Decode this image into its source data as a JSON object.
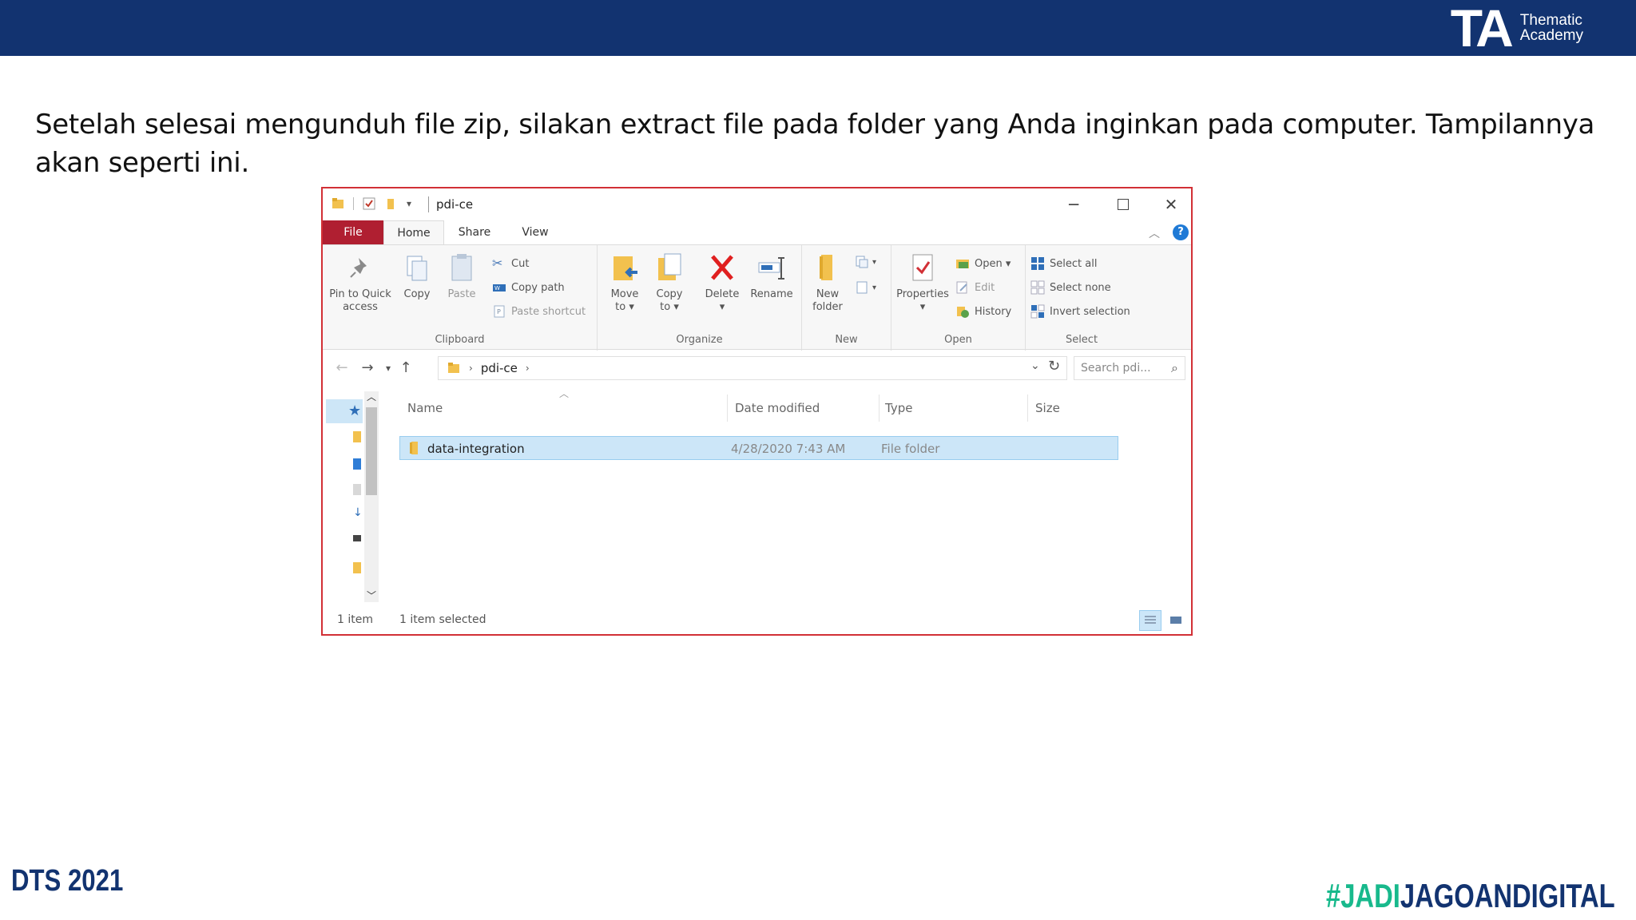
{
  "header": {
    "brand_mark": "TA",
    "brand_line1": "Thematic",
    "brand_line2": "Academy"
  },
  "intro_text": "Setelah selesai mengunduh file zip, silakan extract file pada folder yang Anda inginkan pada computer. Tampilannya akan seperti ini.",
  "explorer": {
    "title": "pdi-ce",
    "tabs": {
      "file": "File",
      "home": "Home",
      "share": "Share",
      "view": "View"
    },
    "ribbon": {
      "clipboard": {
        "label": "Clipboard",
        "pin_line1": "Pin to Quick",
        "pin_line2": "access",
        "copy": "Copy",
        "paste": "Paste",
        "cut": "Cut",
        "copy_path": "Copy path",
        "paste_shortcut": "Paste shortcut"
      },
      "organize": {
        "label": "Organize",
        "move_line1": "Move",
        "move_line2": "to ▾",
        "copy_line1": "Copy",
        "copy_line2": "to ▾",
        "delete_line1": "Delete",
        "delete_line2": "▾",
        "rename": "Rename"
      },
      "new": {
        "label": "New",
        "folder_line1": "New",
        "folder_line2": "folder"
      },
      "open": {
        "label": "Open",
        "properties_line1": "Properties",
        "properties_line2": "▾",
        "open": "Open ▾",
        "edit": "Edit",
        "history": "History"
      },
      "select": {
        "label": "Select",
        "select_all": "Select all",
        "select_none": "Select none",
        "invert": "Invert selection"
      }
    },
    "address": {
      "crumb": "pdi-ce",
      "search_placeholder": "Search pdi..."
    },
    "columns": {
      "name": "Name",
      "date": "Date modified",
      "type": "Type",
      "size": "Size"
    },
    "files": [
      {
        "name": "data-integration",
        "date": "4/28/2020 7:43 AM",
        "type": "File folder",
        "size": ""
      }
    ],
    "status": {
      "count": "1 item",
      "selected": "1 item selected"
    }
  },
  "footer": {
    "left": "DTS 2021",
    "tag_a": "#JADI",
    "tag_b": "JAGOANDIGITAL"
  },
  "colors": {
    "header_bg": "#123370",
    "file_tab": "#b01f31",
    "window_border": "#d23036",
    "selection": "#cce6f8",
    "tag_green": "#18b98c"
  }
}
